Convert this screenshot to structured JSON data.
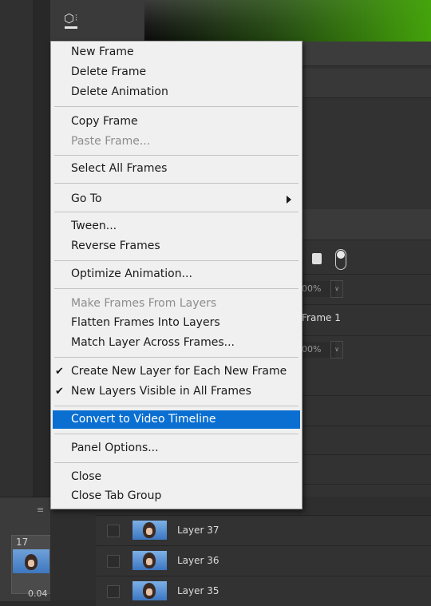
{
  "menu": {
    "items": {
      "new_frame": "New Frame",
      "delete_frame": "Delete Frame",
      "delete_animation": "Delete Animation",
      "copy_frame": "Copy Frame",
      "paste_frame": "Paste Frame...",
      "select_all_frames": "Select All Frames",
      "go_to": "Go To",
      "tween": "Tween...",
      "reverse_frames": "Reverse Frames",
      "optimize_animation": "Optimize Animation...",
      "make_frames_from_layers": "Make Frames From Layers",
      "flatten_frames_into_layers": "Flatten Frames Into Layers",
      "match_layer_across_frames": "Match Layer Across Frames...",
      "create_new_layer": "Create New Layer for Each New Frame",
      "new_layers_visible": "New Layers Visible in All Frames",
      "convert_to_video_timeline": "Convert to Video Timeline",
      "panel_options": "Panel Options...",
      "close": "Close",
      "close_tab_group": "Close Tab Group"
    },
    "checked": [
      "create_new_layer",
      "new_layers_visible"
    ],
    "disabled": [
      "paste_frame",
      "make_frames_from_layers"
    ],
    "highlighted": "convert_to_video_timeline",
    "highlight_color": "#0a6fd1"
  },
  "layers_panel": {
    "opacity_1": "00%",
    "fill_1": "00%",
    "frame_label": "Frame 1"
  },
  "timeline": {
    "frame_number": "17",
    "frame_delay": "0.04"
  },
  "layers": [
    {
      "name": "Layer 37"
    },
    {
      "name": "Layer 36"
    },
    {
      "name": "Layer 35"
    }
  ],
  "icons": [
    "3d-box-icon",
    "lock-icon",
    "toggle-icon",
    "checkmark-icon",
    "submenu-arrow-icon",
    "panel-menu-icon"
  ]
}
